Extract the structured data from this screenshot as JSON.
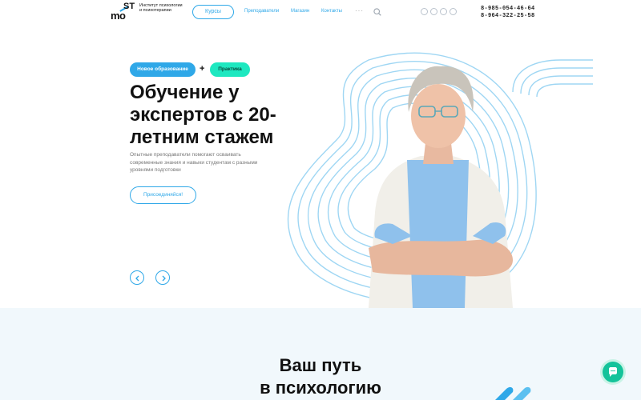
{
  "header": {
    "logo": {
      "mo": "mo",
      "st": "ST"
    },
    "logo_text": "Институт психологии и психотерапии",
    "courses_label": "Курсы",
    "nav": [
      "Преподаватели",
      "Магазин",
      "Контакты"
    ],
    "more": "···",
    "phones": [
      "8-985-054-46-64",
      "8-964-322-25-58"
    ]
  },
  "hero": {
    "tag_primary": "Новое образование",
    "tag_plus": "+",
    "tag_secondary": "Практика",
    "title": "Обучение у экспертов с 20-летним стажем",
    "description": "Опытные преподаватели помогают осваивать современные знания и навыки студентам с разными уровнями подготовки",
    "cta": "Присоединяйся!"
  },
  "section": {
    "title_line1": "Ваш путь",
    "title_line2": "в психологию"
  },
  "colors": {
    "accent_blue": "#2fa8e8",
    "accent_green": "#1ee8c0",
    "chat_green": "#14c39a",
    "section_bg": "#f1f8fc"
  },
  "icons": [
    "search-icon",
    "vk-icon",
    "youtube-icon",
    "telegram-icon",
    "whatsapp-icon",
    "arrow-left-icon",
    "arrow-right-icon",
    "chat-icon"
  ]
}
